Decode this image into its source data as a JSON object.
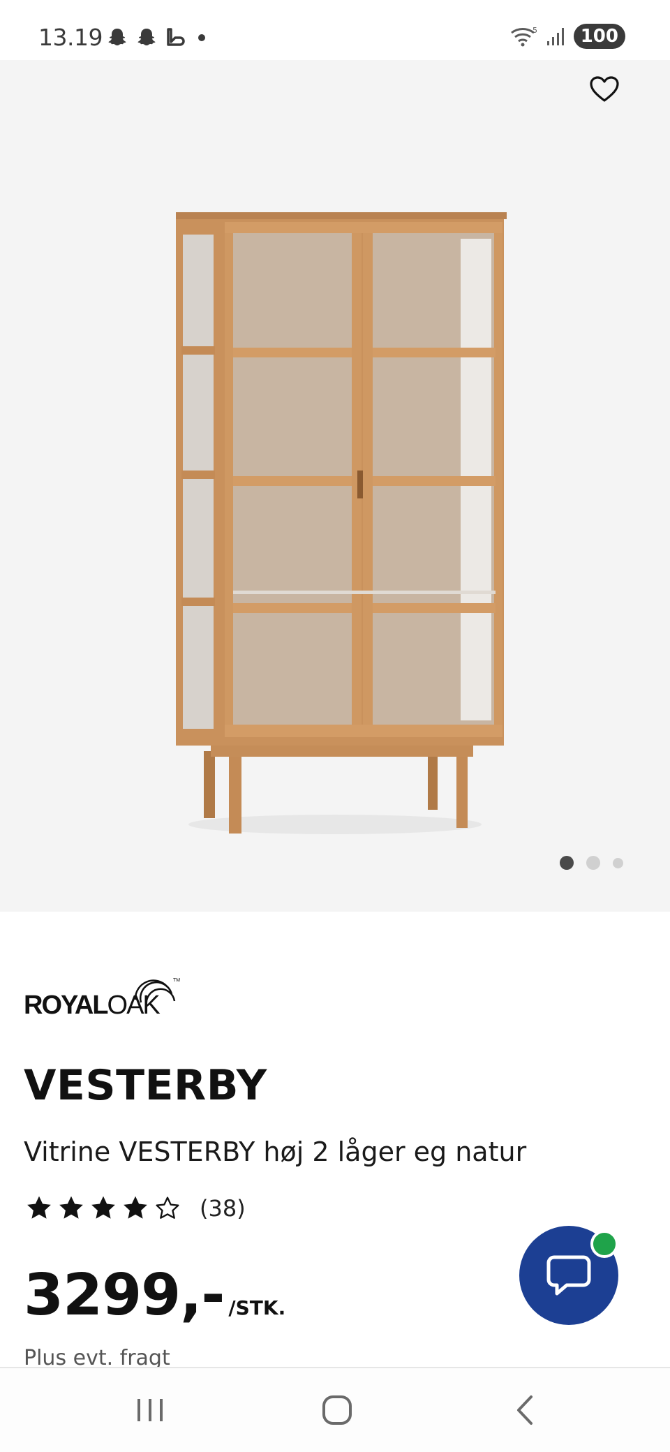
{
  "status_bar": {
    "time": "13.19",
    "left_icons": [
      "snapchat-icon",
      "snapchat-icon",
      "mobilepay-icon",
      "notification-dot-icon"
    ],
    "right_icons": [
      "wifi-icon",
      "signal-icon"
    ],
    "battery": "100"
  },
  "hero": {
    "image_alt": "Vitrine VESTERBY høj 2 låger eg natur",
    "page_indicator": {
      "count": 3,
      "active": 0
    }
  },
  "product": {
    "brand": "ROYALOAK",
    "title": "VESTERBY",
    "subtitle": "Vitrine VESTERBY høj 2 låger eg natur",
    "rating": 4,
    "rating_max": 5,
    "review_count": "(38)",
    "price": "3299,-",
    "price_unit": "/STK.",
    "shipping_note": "Plus evt. fragt"
  },
  "chat": {
    "online": true
  },
  "colors": {
    "hero_bg": "#f4f4f4",
    "chat_blue": "#1c3f93",
    "online_green": "#1fa34a",
    "wood": "#c9915c"
  },
  "nav": {
    "icons": [
      "recent-apps-icon",
      "home-icon",
      "back-icon"
    ]
  }
}
